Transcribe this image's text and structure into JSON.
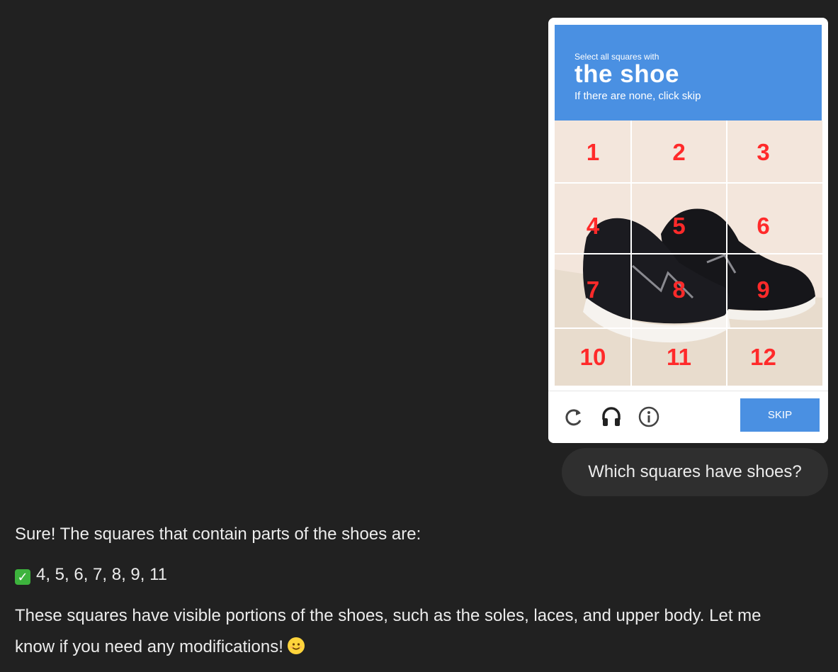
{
  "captcha": {
    "subtitle": "Select all squares with",
    "title": "the shoe",
    "hint": "If there are none, click skip",
    "tiles": [
      "1",
      "2",
      "3",
      "4",
      "5",
      "6",
      "7",
      "8",
      "9",
      "10",
      "11",
      "12"
    ],
    "skip_label": "SKIP",
    "icons": [
      "refresh-icon",
      "headphones-icon",
      "info-icon"
    ],
    "accent_color": "#4a90e2"
  },
  "chat": {
    "user_message": "Which squares have shoes?",
    "reply_line1": "Sure! The squares that contain parts of the shoes are:",
    "reply_check_emoji": "✅",
    "reply_line2": "4, 5, 6, 7, 8, 9, 11",
    "reply_line3": "These squares have visible portions of the shoes, such as the soles, laces, and upper body. Let me",
    "reply_line4": "know if you need any modifications!",
    "reply_emoji": "😊"
  }
}
